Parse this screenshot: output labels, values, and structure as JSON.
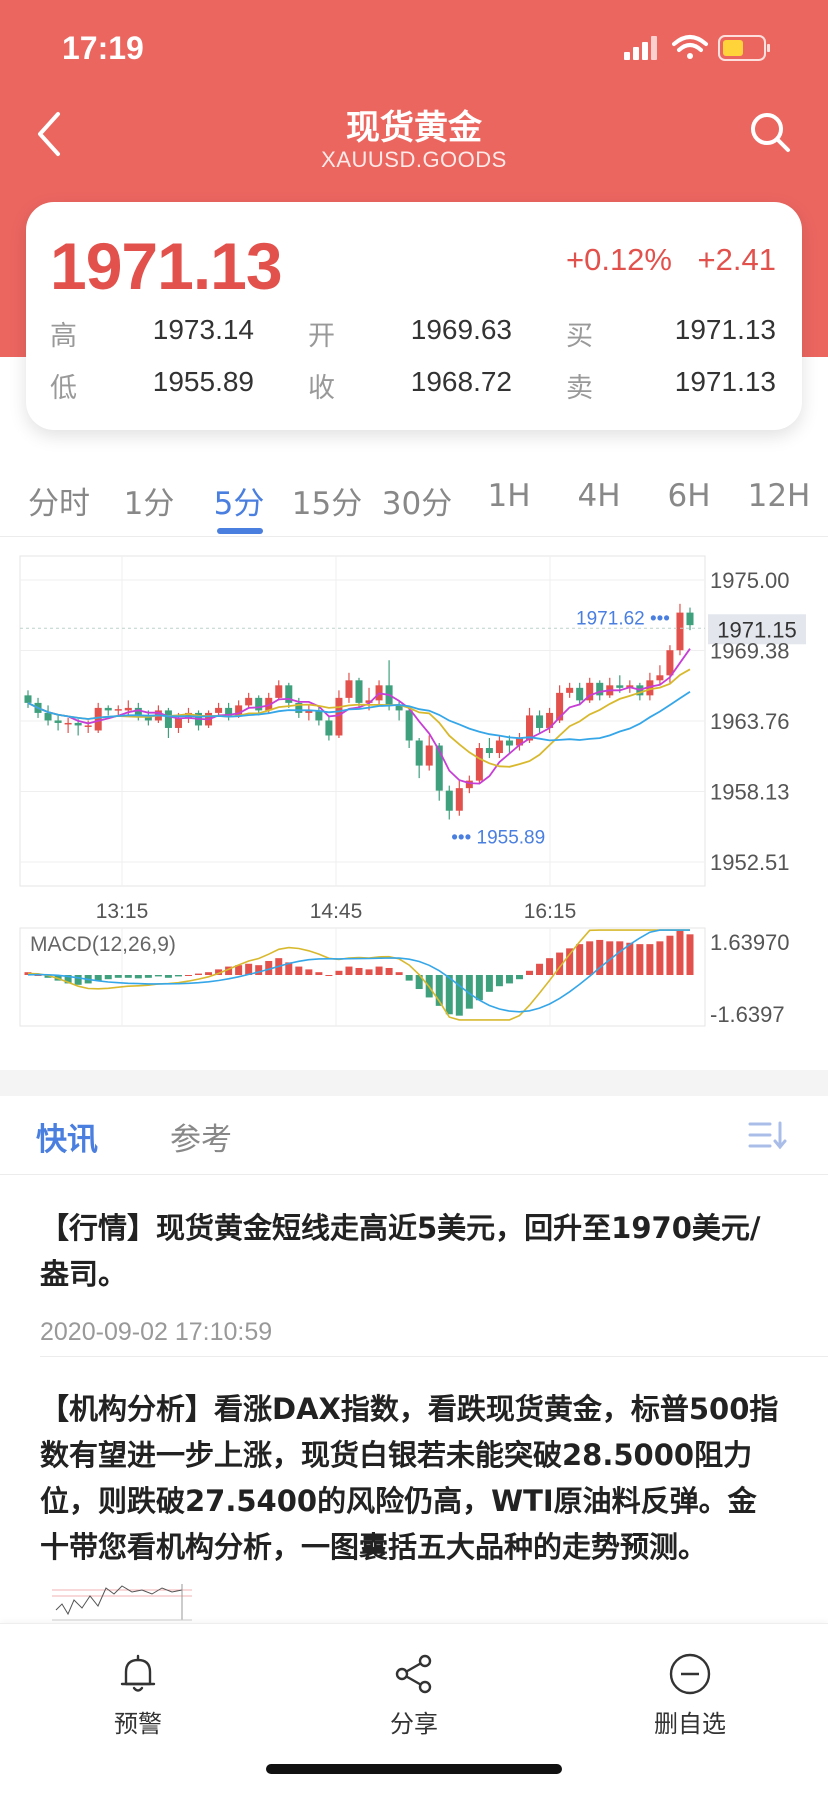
{
  "status": {
    "time": "17:19"
  },
  "header": {
    "title": "现货黄金",
    "code": "XAUUSD.GOODS"
  },
  "quote": {
    "price": "1971.13",
    "change_pct": "+0.12%",
    "change_abs": "+2.41",
    "rows": [
      [
        {
          "label": "高",
          "value": "1973.14"
        },
        {
          "label": "开",
          "value": "1969.63"
        },
        {
          "label": "买",
          "value": "1971.13"
        }
      ],
      [
        {
          "label": "低",
          "value": "1955.89"
        },
        {
          "label": "收",
          "value": "1968.72"
        },
        {
          "label": "卖",
          "value": "1971.13"
        }
      ]
    ]
  },
  "period_tabs": {
    "items": [
      "分时",
      "1分",
      "5分",
      "15分",
      "30分",
      "1H",
      "4H",
      "6H",
      "12H"
    ],
    "active": "5分"
  },
  "chart_data": {
    "type": "candlestick",
    "main": {
      "y_ticks": [
        "1975.00",
        "1969.38",
        "1963.76",
        "1958.13",
        "1952.51"
      ],
      "current_price_label": "1971.15",
      "high_marker": "1971.62",
      "low_marker": "1955.89",
      "x_ticks": [
        "13:15",
        "14:45",
        "16:15"
      ],
      "ylim": [
        1952.51,
        1975.0
      ],
      "candles": [
        {
          "o": 1965.8,
          "c": 1965.2,
          "h": 1966.2,
          "l": 1964.8
        },
        {
          "o": 1965.2,
          "c": 1964.4,
          "h": 1965.6,
          "l": 1964.0
        },
        {
          "o": 1964.4,
          "c": 1963.8,
          "h": 1965.0,
          "l": 1963.4
        },
        {
          "o": 1963.8,
          "c": 1963.6,
          "h": 1964.2,
          "l": 1963.0
        },
        {
          "o": 1963.6,
          "c": 1963.6,
          "h": 1964.0,
          "l": 1962.8
        },
        {
          "o": 1963.6,
          "c": 1963.4,
          "h": 1963.9,
          "l": 1962.6
        },
        {
          "o": 1963.4,
          "c": 1963.4,
          "h": 1963.8,
          "l": 1962.8
        },
        {
          "o": 1963.0,
          "c": 1964.8,
          "h": 1965.2,
          "l": 1962.8
        },
        {
          "o": 1964.8,
          "c": 1964.6,
          "h": 1965.0,
          "l": 1964.2
        },
        {
          "o": 1964.6,
          "c": 1964.7,
          "h": 1965.0,
          "l": 1964.2
        },
        {
          "o": 1964.6,
          "c": 1964.8,
          "h": 1965.4,
          "l": 1964.2
        },
        {
          "o": 1964.8,
          "c": 1964.2,
          "h": 1965.2,
          "l": 1963.8
        },
        {
          "o": 1964.2,
          "c": 1963.8,
          "h": 1964.6,
          "l": 1963.4
        },
        {
          "o": 1963.8,
          "c": 1964.6,
          "h": 1965.0,
          "l": 1963.6
        },
        {
          "o": 1964.6,
          "c": 1963.2,
          "h": 1964.8,
          "l": 1962.4
        },
        {
          "o": 1963.2,
          "c": 1964.0,
          "h": 1964.4,
          "l": 1962.8
        },
        {
          "o": 1964.0,
          "c": 1964.4,
          "h": 1964.8,
          "l": 1963.6
        },
        {
          "o": 1964.4,
          "c": 1963.4,
          "h": 1964.6,
          "l": 1963.0
        },
        {
          "o": 1963.4,
          "c": 1964.4,
          "h": 1964.6,
          "l": 1963.2
        },
        {
          "o": 1964.4,
          "c": 1964.8,
          "h": 1965.2,
          "l": 1964.2
        },
        {
          "o": 1964.8,
          "c": 1964.2,
          "h": 1965.2,
          "l": 1963.8
        },
        {
          "o": 1964.2,
          "c": 1965.0,
          "h": 1965.4,
          "l": 1964.0
        },
        {
          "o": 1965.0,
          "c": 1965.6,
          "h": 1966.0,
          "l": 1964.8
        },
        {
          "o": 1965.6,
          "c": 1964.6,
          "h": 1965.8,
          "l": 1964.2
        },
        {
          "o": 1964.6,
          "c": 1965.6,
          "h": 1966.0,
          "l": 1964.4
        },
        {
          "o": 1965.6,
          "c": 1966.6,
          "h": 1967.0,
          "l": 1965.4
        },
        {
          "o": 1966.6,
          "c": 1965.2,
          "h": 1966.8,
          "l": 1964.8
        },
        {
          "o": 1965.2,
          "c": 1964.4,
          "h": 1965.6,
          "l": 1964.0
        },
        {
          "o": 1964.4,
          "c": 1964.6,
          "h": 1965.0,
          "l": 1963.8
        },
        {
          "o": 1964.6,
          "c": 1963.8,
          "h": 1965.0,
          "l": 1963.4
        },
        {
          "o": 1963.8,
          "c": 1962.6,
          "h": 1964.2,
          "l": 1962.2
        },
        {
          "o": 1962.6,
          "c": 1965.6,
          "h": 1966.2,
          "l": 1962.4
        },
        {
          "o": 1965.6,
          "c": 1967.0,
          "h": 1967.6,
          "l": 1965.2
        },
        {
          "o": 1967.0,
          "c": 1965.2,
          "h": 1967.2,
          "l": 1964.8
        },
        {
          "o": 1965.2,
          "c": 1965.4,
          "h": 1966.4,
          "l": 1964.6
        },
        {
          "o": 1965.4,
          "c": 1966.6,
          "h": 1967.0,
          "l": 1965.0
        },
        {
          "o": 1966.6,
          "c": 1965.0,
          "h": 1968.6,
          "l": 1964.6
        },
        {
          "o": 1965.0,
          "c": 1964.6,
          "h": 1965.4,
          "l": 1963.8
        },
        {
          "o": 1964.6,
          "c": 1962.2,
          "h": 1964.8,
          "l": 1961.6
        },
        {
          "o": 1962.2,
          "c": 1960.2,
          "h": 1962.4,
          "l": 1959.2
        },
        {
          "o": 1960.2,
          "c": 1961.8,
          "h": 1962.6,
          "l": 1959.8
        },
        {
          "o": 1961.8,
          "c": 1958.2,
          "h": 1962.0,
          "l": 1957.4
        },
        {
          "o": 1958.2,
          "c": 1956.6,
          "h": 1958.6,
          "l": 1955.9
        },
        {
          "o": 1956.6,
          "c": 1958.4,
          "h": 1959.0,
          "l": 1956.2
        },
        {
          "o": 1958.4,
          "c": 1959.0,
          "h": 1959.4,
          "l": 1958.0
        },
        {
          "o": 1959.0,
          "c": 1961.6,
          "h": 1962.0,
          "l": 1958.8
        },
        {
          "o": 1961.6,
          "c": 1961.2,
          "h": 1962.4,
          "l": 1960.8
        },
        {
          "o": 1961.2,
          "c": 1962.2,
          "h": 1962.6,
          "l": 1960.8
        },
        {
          "o": 1962.2,
          "c": 1961.8,
          "h": 1962.6,
          "l": 1961.2
        },
        {
          "o": 1961.8,
          "c": 1962.4,
          "h": 1962.8,
          "l": 1961.4
        },
        {
          "o": 1962.2,
          "c": 1964.2,
          "h": 1964.8,
          "l": 1962.0
        },
        {
          "o": 1964.2,
          "c": 1963.2,
          "h": 1964.6,
          "l": 1962.8
        },
        {
          "o": 1963.2,
          "c": 1964.4,
          "h": 1964.8,
          "l": 1962.8
        },
        {
          "o": 1963.8,
          "c": 1966.0,
          "h": 1966.6,
          "l": 1963.6
        },
        {
          "o": 1966.0,
          "c": 1966.4,
          "h": 1966.8,
          "l": 1965.6
        },
        {
          "o": 1966.4,
          "c": 1965.4,
          "h": 1966.8,
          "l": 1965.0
        },
        {
          "o": 1965.4,
          "c": 1966.8,
          "h": 1967.2,
          "l": 1965.2
        },
        {
          "o": 1966.8,
          "c": 1965.8,
          "h": 1967.0,
          "l": 1965.4
        },
        {
          "o": 1965.8,
          "c": 1966.6,
          "h": 1967.2,
          "l": 1965.6
        },
        {
          "o": 1966.6,
          "c": 1966.4,
          "h": 1967.4,
          "l": 1966.0
        },
        {
          "o": 1966.4,
          "c": 1966.6,
          "h": 1967.0,
          "l": 1966.0
        },
        {
          "o": 1966.6,
          "c": 1965.8,
          "h": 1966.8,
          "l": 1965.4
        },
        {
          "o": 1965.8,
          "c": 1967.0,
          "h": 1967.6,
          "l": 1965.4
        },
        {
          "o": 1967.0,
          "c": 1967.4,
          "h": 1968.2,
          "l": 1966.6
        },
        {
          "o": 1967.4,
          "c": 1969.4,
          "h": 1969.8,
          "l": 1966.8
        },
        {
          "o": 1969.4,
          "c": 1972.4,
          "h": 1973.1,
          "l": 1969.0
        },
        {
          "o": 1972.4,
          "c": 1971.4,
          "h": 1972.8,
          "l": 1971.0
        }
      ]
    },
    "macd": {
      "label": "MACD(12,26,9)",
      "y_ticks": [
        "1.63970",
        "-1.6397"
      ],
      "ylim": [
        -1.6397,
        1.6397
      ],
      "hist": [
        0.1,
        0.0,
        -0.1,
        -0.2,
        -0.3,
        -0.35,
        -0.3,
        -0.2,
        -0.15,
        -0.1,
        -0.1,
        -0.12,
        -0.1,
        -0.05,
        -0.1,
        -0.05,
        0.0,
        0.05,
        0.1,
        0.2,
        0.3,
        0.35,
        0.4,
        0.35,
        0.5,
        0.6,
        0.45,
        0.3,
        0.2,
        0.1,
        0.0,
        0.15,
        0.3,
        0.25,
        0.2,
        0.3,
        0.25,
        0.1,
        -0.2,
        -0.5,
        -0.8,
        -1.1,
        -1.4,
        -1.45,
        -1.2,
        -0.9,
        -0.6,
        -0.4,
        -0.3,
        -0.15,
        0.15,
        0.4,
        0.6,
        0.8,
        0.95,
        1.1,
        1.2,
        1.25,
        1.2,
        1.2,
        1.15,
        1.1,
        1.1,
        1.2,
        1.4,
        1.6,
        1.45
      ]
    }
  },
  "news_tabs": {
    "active": "快讯",
    "inactive": "参考",
    "list_icon": "list-sort-icon"
  },
  "news": [
    {
      "text": "【行情】现货黄金短线走高近5美元，回升至1970美元/盎司。",
      "time": "2020-09-02 17:10:59"
    },
    {
      "text": "【机构分析】看涨DAX指数，看跌现货黄金，标普500指数有望进一步上涨，现货白银若未能突破28.5000阻力位，则跌破27.5400的风险仍高，WTI原油料反弹。金十带您看机构分析，一图囊括五大品种的走势预测。"
    }
  ],
  "bottom_bar": {
    "alert": {
      "label": "预警",
      "icon": "bell-icon"
    },
    "share": {
      "label": "分享",
      "icon": "share-icon"
    },
    "remove": {
      "label": "删自选",
      "icon": "minus-circle-icon"
    }
  },
  "colors": {
    "header": "#ec6660",
    "up": "#e2514c",
    "down": "#3fa07e",
    "accent": "#4a7fe0"
  }
}
